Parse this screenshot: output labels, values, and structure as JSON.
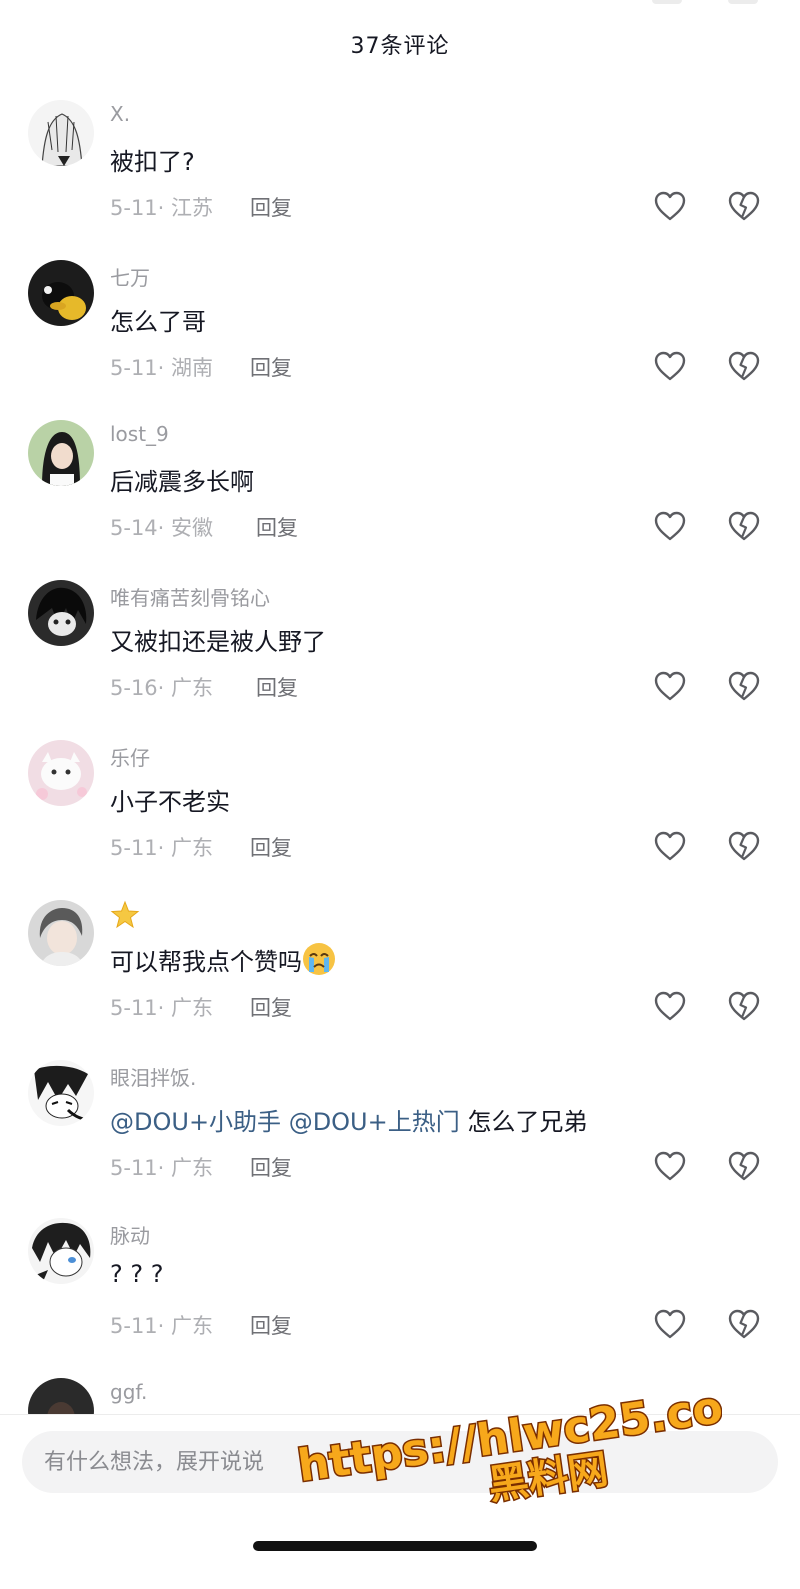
{
  "header": {
    "title": "37条评论"
  },
  "comments": [
    {
      "username": "X.",
      "text": "被扣了?",
      "meta": "5-11· 江苏",
      "reply": "回复",
      "avatar": "avatar-manga-girl"
    },
    {
      "username": "七万",
      "text": "怎么了哥",
      "meta": "5-11· 湖南",
      "reply": "回复",
      "avatar": "avatar-penguin"
    },
    {
      "username": "lost_9",
      "text": "后减震多长啊",
      "meta": "5-14· 安徽",
      "reply": "回复",
      "avatar": "avatar-girl-photo"
    },
    {
      "username": "唯有痛苦刻骨铭心",
      "text": "又被扣还是被人野了",
      "meta": "5-16· 广东",
      "reply": "回复",
      "avatar": "avatar-dark-anime"
    },
    {
      "username": "乐仔",
      "text": "小子不老实",
      "meta": "5-11· 广东",
      "reply": "回复",
      "avatar": "avatar-white-cat"
    },
    {
      "username": "",
      "text": "可以帮我点个赞吗",
      "meta": "5-11· 广东",
      "reply": "回复",
      "avatar": "avatar-boy-photo",
      "badge": "star-icon",
      "emoji": "crying-emoji"
    },
    {
      "username": "眼泪拌饭.",
      "mention1": "@DOU+小助手",
      "mention2": "@DOU+上热门",
      "text": "怎么了兄弟",
      "meta": "5-11· 广东",
      "reply": "回复",
      "avatar": "avatar-anime-boy"
    },
    {
      "username": "脉动",
      "text": "? ? ?",
      "meta": "5-11· 广东",
      "reply": "回复",
      "avatar": "avatar-anime-blue-eye"
    },
    {
      "username": "ggf.",
      "avatar": "avatar-dark"
    }
  ],
  "input": {
    "placeholder": "有什么想法，展开说说"
  },
  "watermark": {
    "url": "https://hlwc25.com",
    "name": "黑料网"
  },
  "icons": {
    "like": "heart-outline-icon",
    "dislike": "broken-heart-icon"
  },
  "colors": {
    "mention": "#3b5f85",
    "watermark_fill": "#f7a81b",
    "watermark_stroke": "#7a2e00"
  }
}
